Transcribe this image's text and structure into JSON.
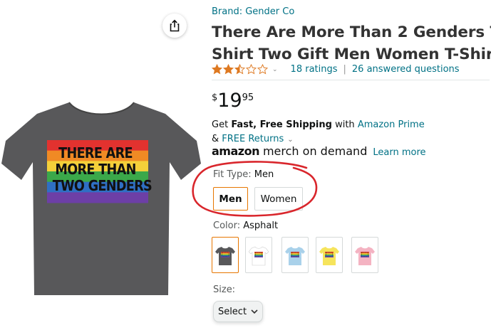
{
  "product": {
    "brand": "Brand: Gender Co",
    "title_lines": [
      "There Are More Than 2 Genders T",
      "Shirt Two Gift Men Women T-Shirt"
    ],
    "rating": 2.5,
    "rating_max": 5,
    "ratings_link": "18 ratings",
    "questions_link": "26 answered questions",
    "price": {
      "symbol": "$",
      "whole": "19",
      "fraction": "95"
    }
  },
  "shipping": {
    "line1_prefix": "Get ",
    "line1_bold": "Fast, Free Shipping",
    "line1_mid": " with ",
    "line1_link": "Amazon Prime",
    "line2_prefix": "& ",
    "line2_link": "FREE Returns"
  },
  "merch": {
    "logo": "amazon",
    "text": "merch on demand",
    "learn_more": "Learn more"
  },
  "image": {
    "shirt_color": "#58585a",
    "print_lines": [
      "THERE ARE",
      "MORE THAN",
      "TWO GENDERS"
    ],
    "rainbow": [
      "#e2322f",
      "#f08a24",
      "#f4d03a",
      "#3ba84a",
      "#2f6fc4",
      "#6d3fa6"
    ]
  },
  "fit": {
    "label": "Fit Type: ",
    "selected": "Men",
    "options": [
      "Men",
      "Women"
    ]
  },
  "color": {
    "label": "Color: ",
    "selected": "Asphalt",
    "swatches": [
      {
        "name": "Asphalt",
        "hex": "#58585a",
        "selected": true
      },
      {
        "name": "White",
        "hex": "#ffffff",
        "selected": false
      },
      {
        "name": "Baby Blue",
        "hex": "#a9d1ea",
        "selected": false
      },
      {
        "name": "Yellow",
        "hex": "#f6e45c",
        "selected": false
      },
      {
        "name": "Pink",
        "hex": "#f4b3c2",
        "selected": false
      }
    ]
  },
  "size": {
    "label": "Size:",
    "select_label": "Select"
  },
  "colors": {
    "link": "#007185",
    "star": "#de7921",
    "selected_border": "#e77600",
    "annotation_circle": "#d9262c"
  }
}
